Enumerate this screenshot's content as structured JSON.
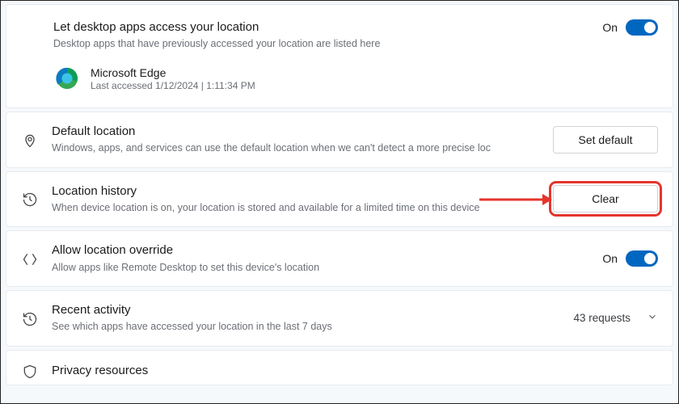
{
  "desktop_apps": {
    "title": "Let desktop apps access your location",
    "subtitle": "Desktop apps that have previously accessed your location are listed here",
    "toggle_state": "On",
    "app": {
      "name": "Microsoft Edge",
      "meta": "Last accessed 1/12/2024  |  1:11:34 PM"
    }
  },
  "default_location": {
    "title": "Default location",
    "subtitle": "Windows, apps, and services can use the default location when we can't detect a more precise loc",
    "button": "Set default"
  },
  "location_history": {
    "title": "Location history",
    "subtitle": "When device location is on, your location is stored and available for a limited time on this device",
    "button": "Clear"
  },
  "location_override": {
    "title": "Allow location override",
    "subtitle": "Allow apps like Remote Desktop to set this device's location",
    "toggle_state": "On"
  },
  "recent_activity": {
    "title": "Recent activity",
    "subtitle": "See which apps have accessed your location in the last 7 days",
    "requests": "43 requests"
  },
  "privacy_resources": {
    "title": "Privacy resources"
  }
}
